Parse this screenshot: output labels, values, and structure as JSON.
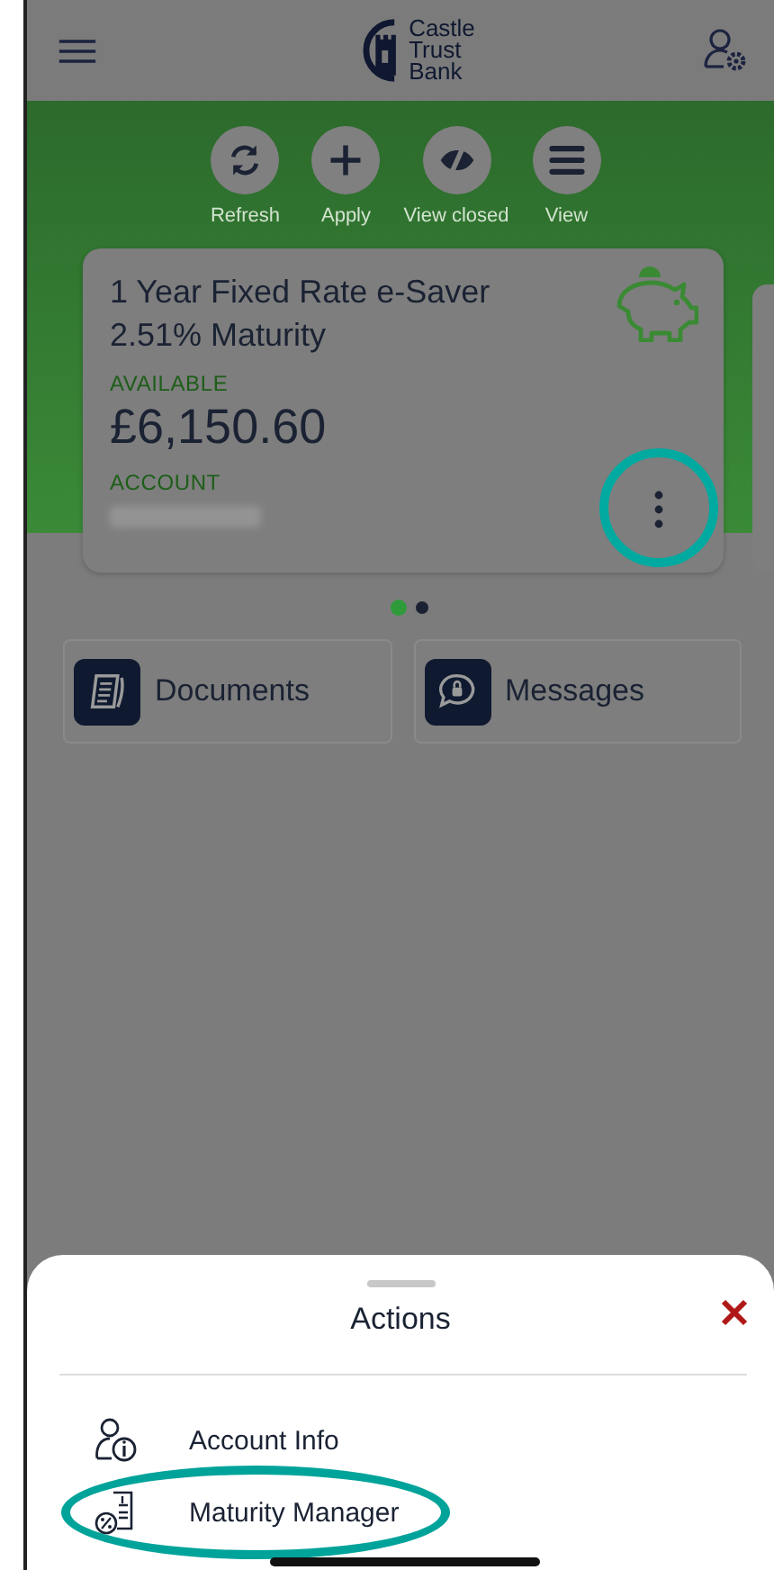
{
  "header": {
    "logo_lines": [
      "Castle",
      "Trust",
      "Bank"
    ]
  },
  "actions": [
    {
      "label": "Refresh",
      "kind": "refresh"
    },
    {
      "label": "Apply",
      "kind": "apply"
    },
    {
      "label": "View closed",
      "kind": "hidden"
    },
    {
      "label": "View",
      "kind": "view"
    }
  ],
  "card": {
    "title": "1 Year Fixed Rate e-Saver 2.51% Maturity",
    "available_label": "AVAILABLE",
    "amount": "£6,150.60",
    "account_label": "ACCOUNT"
  },
  "pager": [
    {
      "selected": true
    },
    {
      "selected": false
    }
  ],
  "tiles": [
    {
      "label": "Documents",
      "kind": "documents"
    },
    {
      "label": "Messages",
      "kind": "messages"
    }
  ],
  "sheet": {
    "title": "Actions",
    "items": [
      {
        "label": "Account Info",
        "kind": "info"
      },
      {
        "label": "Maturity Manager",
        "kind": "maturity"
      }
    ]
  }
}
